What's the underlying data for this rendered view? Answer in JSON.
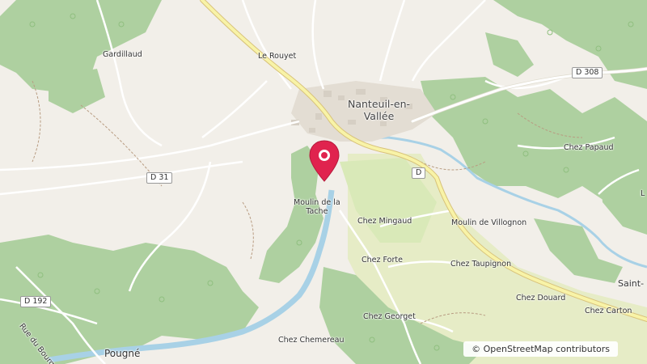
{
  "map": {
    "places": {
      "town": "Nanteuil-en-\nVallée",
      "gardillaud": "Gardillaud",
      "le_rouyet": "Le Rouyet",
      "moulin_tache": "Moulin de la\nTache",
      "chez_mingaud": "Chez Mingaud",
      "moulin_villognon": "Moulin de Villognon",
      "chez_forte": "Chez Forte",
      "chez_taupignon": "Chez Taupignon",
      "chez_papaud": "Chez Papaud",
      "chez_douard": "Chez Douard",
      "chez_carton": "Chez Carton",
      "chez_georget": "Chez Georget",
      "chez_chemereau": "Chez Chemereau",
      "pougne": "Pougné",
      "rue_du_bourg": "Rue du Bourg",
      "saint_partial": "Saint-",
      "edge_l": "L"
    },
    "roads": {
      "d308": "D 308",
      "d31": "D 31",
      "d192": "D 192",
      "d_partial": "D"
    },
    "attribution": "© OpenStreetMap contributors",
    "marker": {
      "label": "selected-location",
      "color": "#e0234e"
    }
  }
}
